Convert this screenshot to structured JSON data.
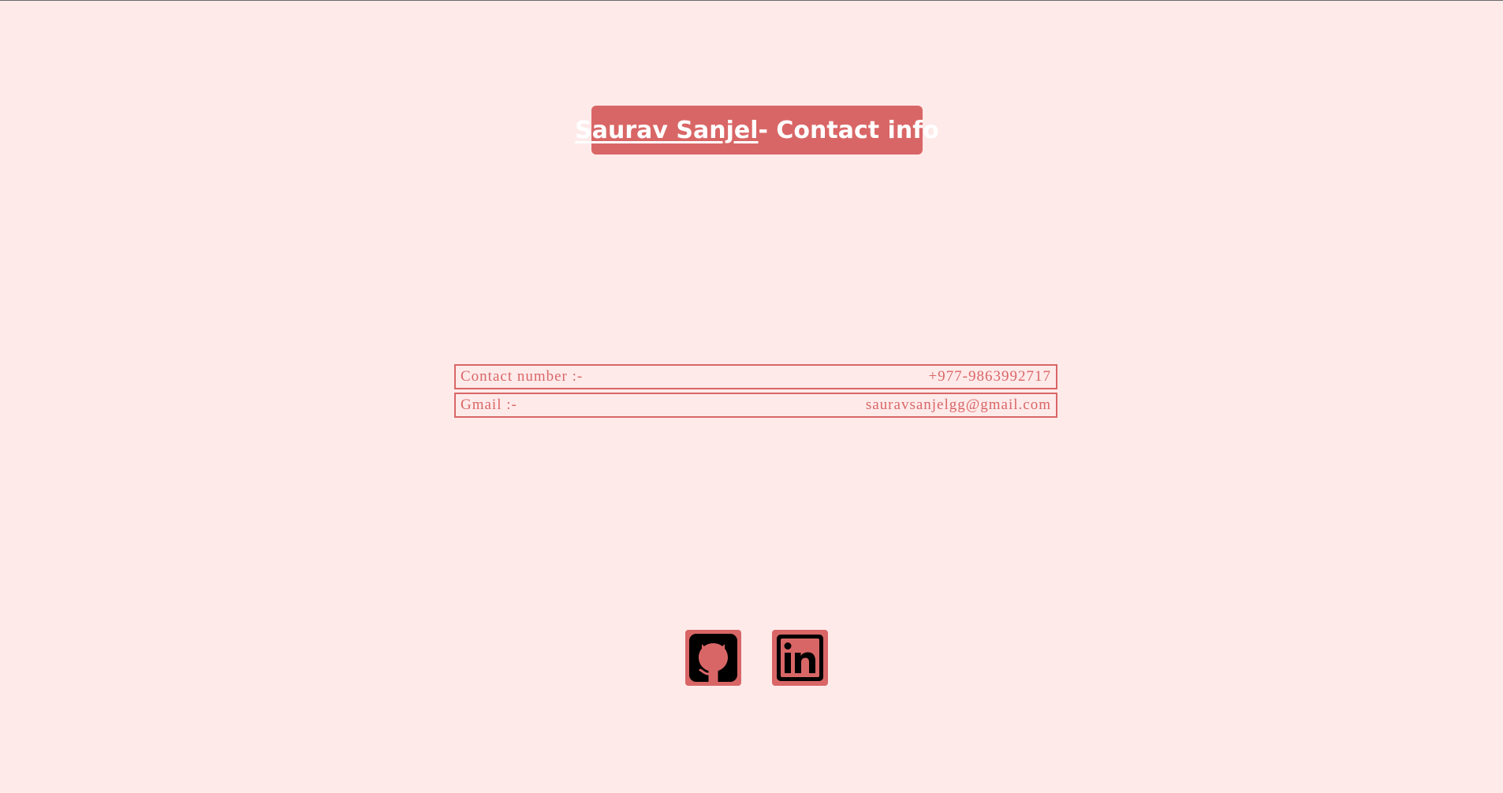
{
  "header": {
    "name_link": "Saurav Sanjel",
    "suffix": "- Contact info"
  },
  "contacts": [
    {
      "label": "Contact number :-",
      "value": "+977-9863992717"
    },
    {
      "label": "Gmail :-",
      "value": "sauravsanjelgg@gmail.com"
    }
  ],
  "social": [
    {
      "icon": "github-icon"
    },
    {
      "icon": "linkedin-icon"
    }
  ],
  "colors": {
    "background": "#ffeaea",
    "accent": "#d96666",
    "icon_dark": "#000000"
  }
}
